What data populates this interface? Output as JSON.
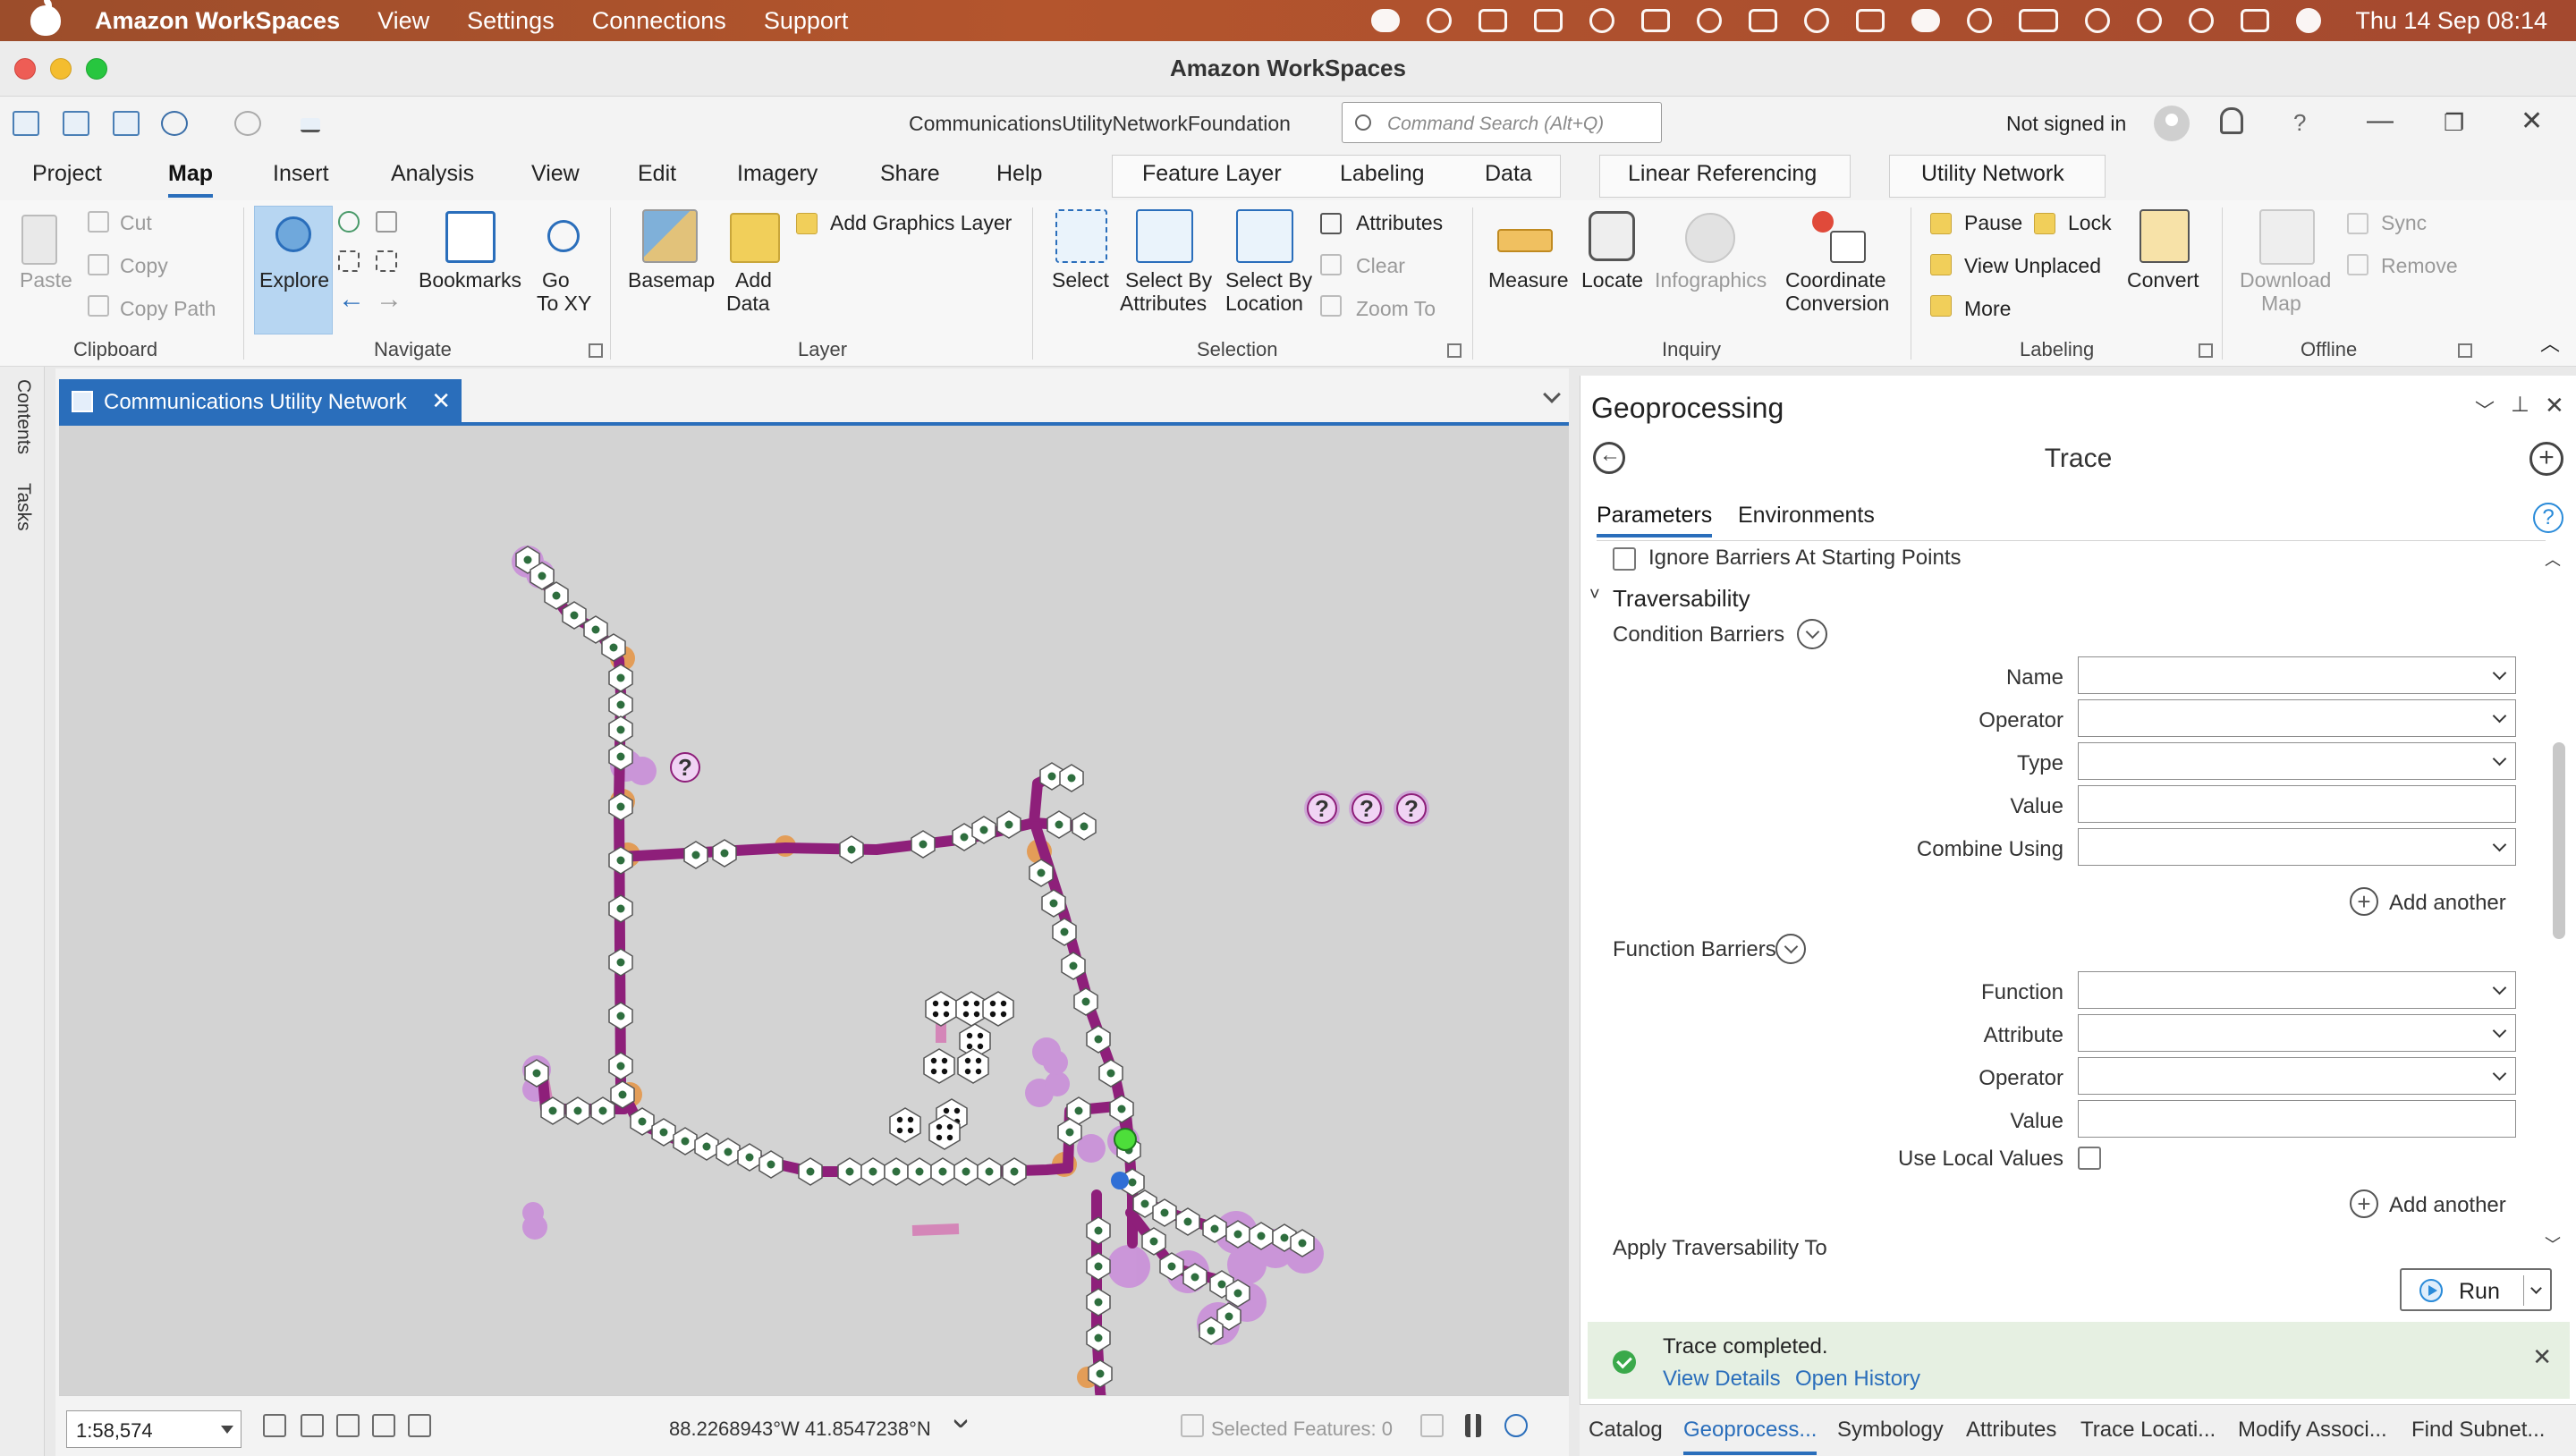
{
  "menubar": {
    "app_name": "Amazon WorkSpaces",
    "items": [
      "View",
      "Settings",
      "Connections",
      "Support"
    ],
    "clock": "Thu 14 Sep  08:14"
  },
  "window": {
    "title": "Amazon WorkSpaces"
  },
  "quick_access": {
    "project_name": "CommunicationsUtilityNetworkFoundation",
    "search_placeholder": "Command Search (Alt+Q)",
    "account_status": "Not signed in",
    "help": "?"
  },
  "ribbon_tabs": {
    "tabs": [
      "Project",
      "Map",
      "Insert",
      "Analysis",
      "View",
      "Edit",
      "Imagery",
      "Share",
      "Help"
    ],
    "active": "Map",
    "context_tabs": [
      "Feature Layer",
      "Labeling",
      "Data",
      "Linear Referencing",
      "Utility Network"
    ]
  },
  "ribbon": {
    "clipboard": {
      "paste": "Paste",
      "cut": "Cut",
      "copy": "Copy",
      "copy_path": "Copy Path",
      "group": "Clipboard"
    },
    "navigate": {
      "explore": "Explore",
      "bookmarks": "Bookmarks",
      "go_to_xy_1": "Go",
      "go_to_xy_2": "To XY",
      "group": "Navigate"
    },
    "layer": {
      "basemap": "Basemap",
      "add_data_1": "Add",
      "add_data_2": "Data",
      "add_graphics_layer": "Add Graphics Layer",
      "group": "Layer"
    },
    "selection": {
      "select": "Select",
      "select_by_attributes_1": "Select By",
      "select_by_attributes_2": "Attributes",
      "select_by_location_1": "Select By",
      "select_by_location_2": "Location",
      "attributes": "Attributes",
      "clear": "Clear",
      "zoom_to": "Zoom To",
      "group": "Selection"
    },
    "inquiry": {
      "measure": "Measure",
      "locate": "Locate",
      "infographics": "Infographics",
      "coordinate_conversion_1": "Coordinate",
      "coordinate_conversion_2": "Conversion",
      "group": "Inquiry"
    },
    "labeling": {
      "pause": "Pause",
      "lock": "Lock",
      "view_unplaced": "View Unplaced",
      "more": "More",
      "convert": "Convert",
      "group": "Labeling"
    },
    "offline": {
      "download_map_1": "Download",
      "download_map_2": "Map",
      "sync": "Sync",
      "remove": "Remove",
      "group": "Offline"
    }
  },
  "side_panels": {
    "contents": "Contents",
    "tasks": "Tasks"
  },
  "map_view": {
    "tab_title": "Communications Utility Network",
    "close": "✕",
    "scale": "1:58,574",
    "coordinates": "88.2268943°W 41.8547238°N",
    "selected_features": "Selected Features: 0",
    "unknown_marker": "?"
  },
  "geoprocessing": {
    "pane_title": "Geoprocessing",
    "tool_title": "Trace",
    "tabs": [
      "Parameters",
      "Environments"
    ],
    "active_tab": "Parameters",
    "ignore_barriers": "Ignore Barriers At Starting Points",
    "traversability": "Traversability",
    "condition_barriers": {
      "title": "Condition Barriers",
      "fields": [
        "Name",
        "Operator",
        "Type",
        "Value",
        "Combine Using"
      ],
      "add_another": "Add another"
    },
    "function_barriers": {
      "title": "Function Barriers",
      "fields": [
        "Function",
        "Attribute",
        "Operator",
        "Value"
      ],
      "use_local_values": "Use Local Values",
      "add_another": "Add another"
    },
    "apply_traversability_to": "Apply Traversability To",
    "run": "Run",
    "message": {
      "text": "Trace completed.",
      "view_details": "View Details",
      "open_history": "Open History"
    }
  },
  "bottom_tabs": {
    "items": [
      "Catalog",
      "Geoprocess...",
      "Symbology",
      "Attributes",
      "Trace Locati...",
      "Modify Associ...",
      "Find Subnet..."
    ],
    "active": "Geoprocess..."
  },
  "colors": {
    "accent": "#2a6ebb",
    "trace_line": "#8e1f7a",
    "trace_halo": "#c88ad8",
    "map_background": "#d3d3d3",
    "success": "#3aa94a"
  }
}
